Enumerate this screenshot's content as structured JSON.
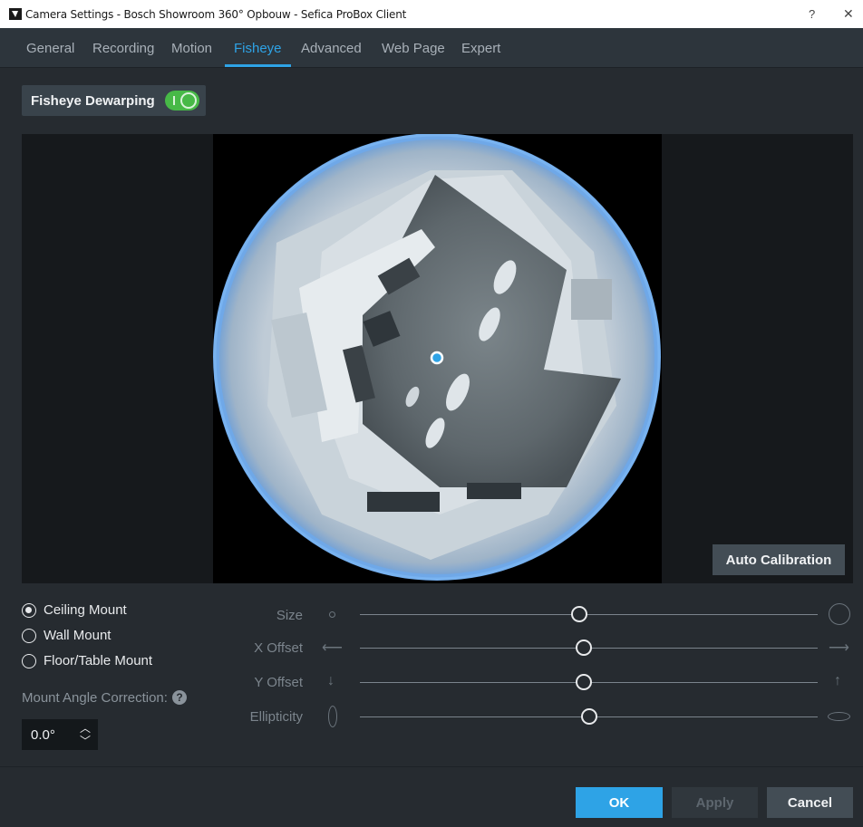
{
  "window": {
    "title": "Camera Settings - Bosch Showroom 360° Opbouw - Sefica ProBox Client",
    "help_glyph": "?",
    "close_glyph": "✕"
  },
  "tabs": [
    {
      "label": "General"
    },
    {
      "label": "Recording"
    },
    {
      "label": "Motion"
    },
    {
      "label": "Fisheye",
      "active": true
    },
    {
      "label": "Advanced"
    },
    {
      "label": "Web Page"
    },
    {
      "label": "Expert"
    }
  ],
  "dewarping": {
    "label": "Fisheye Dewarping",
    "enabled": true
  },
  "preview": {
    "auto_calibration_label": "Auto Calibration"
  },
  "mount": {
    "options": [
      {
        "label": "Ceiling Mount",
        "selected": true
      },
      {
        "label": "Wall Mount",
        "selected": false
      },
      {
        "label": "Floor/Table Mount",
        "selected": false
      }
    ],
    "angle_label": "Mount Angle Correction:",
    "angle_value": "0.0°"
  },
  "sliders": [
    {
      "label": "Size",
      "value": 0.48,
      "min_icon": "small-circle-icon",
      "max_icon": "large-circle-icon"
    },
    {
      "label": "X Offset",
      "value": 0.49,
      "min_icon": "arrow-left-icon",
      "max_icon": "arrow-right-icon"
    },
    {
      "label": "Y Offset",
      "value": 0.49,
      "min_icon": "arrow-down-icon",
      "max_icon": "arrow-up-icon"
    },
    {
      "label": "Ellipticity",
      "value": 0.5,
      "min_icon": "tall-ellipse-icon",
      "max_icon": "wide-ellipse-icon"
    }
  ],
  "buttons": {
    "ok": "OK",
    "apply": "Apply",
    "cancel": "Cancel"
  },
  "colors": {
    "accent": "#2ea3e6",
    "toggle_on": "#47b947",
    "background": "#262b30"
  }
}
